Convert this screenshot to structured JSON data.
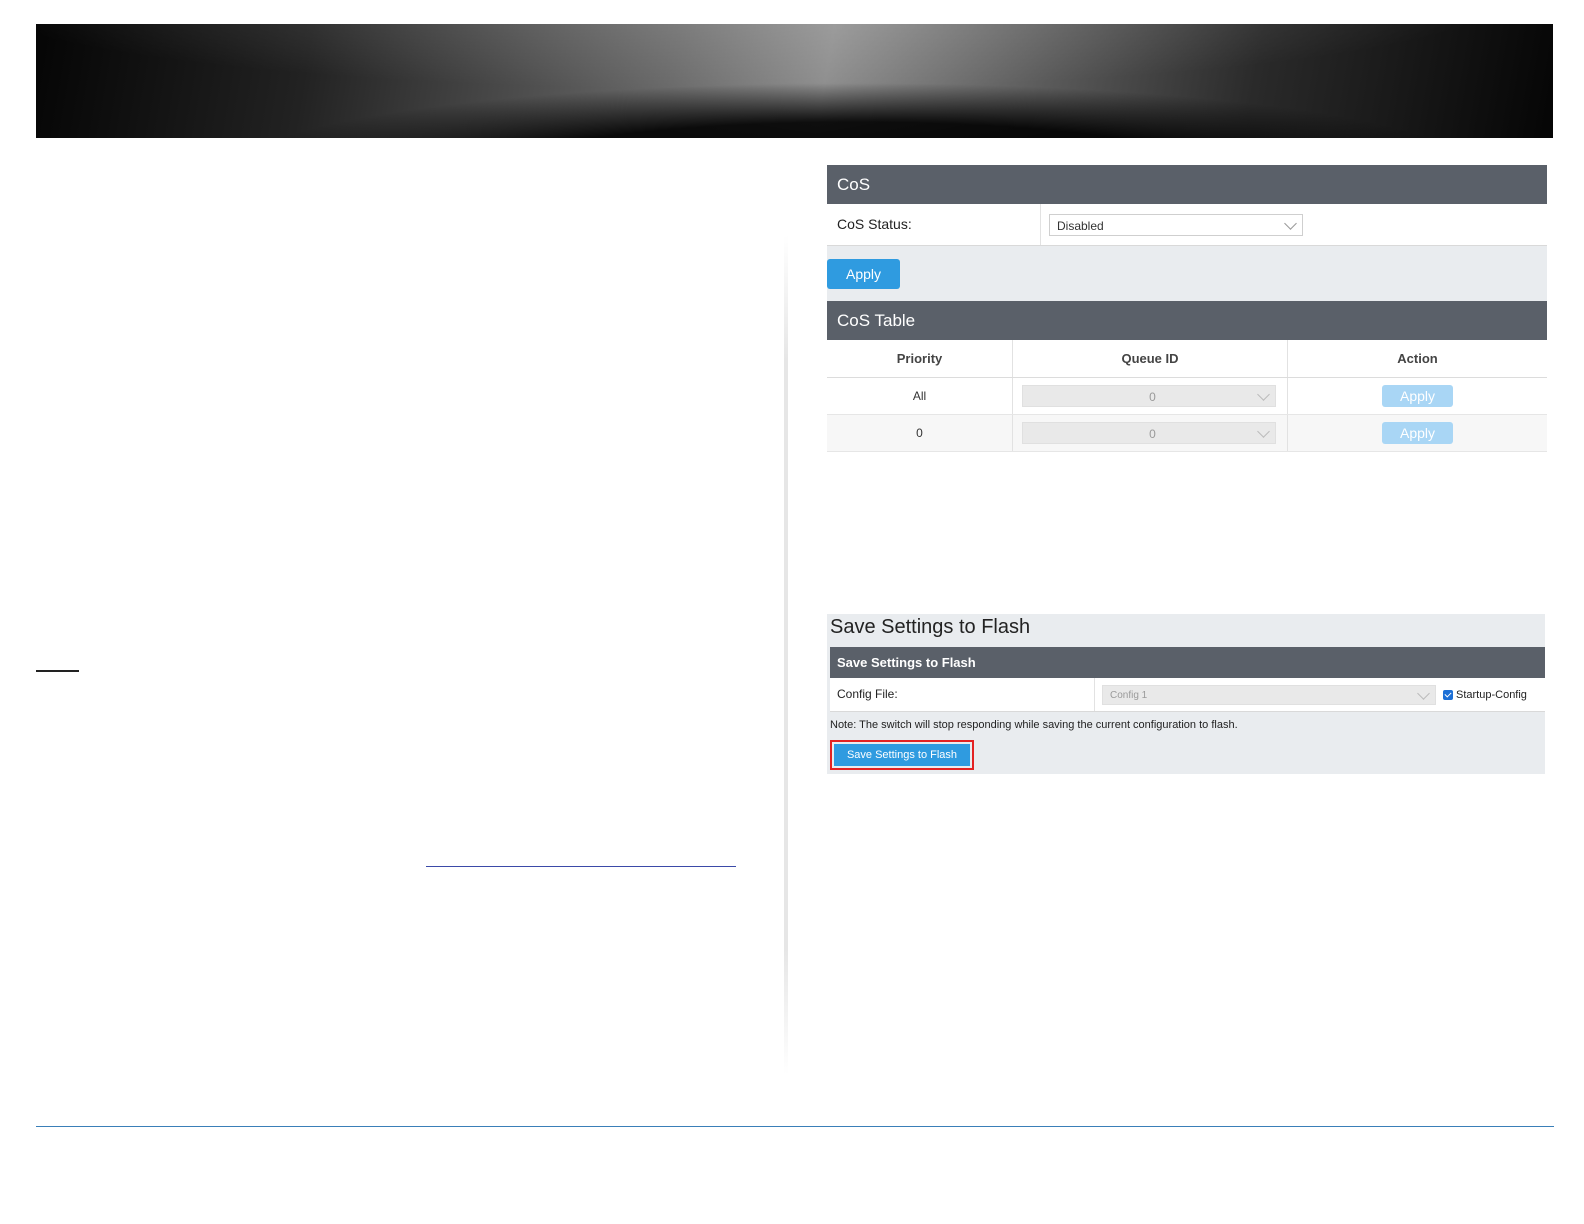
{
  "cos": {
    "header": "CoS",
    "status_label": "CoS Status:",
    "status_value": "Disabled",
    "apply_label": "Apply"
  },
  "cos_table": {
    "header": "CoS Table",
    "columns": [
      "Priority",
      "Queue ID",
      "Action"
    ],
    "rows": [
      {
        "priority": "All",
        "queue_id": "0",
        "action": "Apply"
      },
      {
        "priority": "0",
        "queue_id": "0",
        "action": "Apply"
      }
    ]
  },
  "save": {
    "title": "Save Settings to Flash",
    "header": "Save Settings to Flash",
    "config_label": "Config File:",
    "config_value": "Config 1",
    "startup_label": "Startup-Config",
    "note": "Note: The switch will stop responding while saving the current configuration to flash.",
    "button_label": "Save Settings to Flash"
  },
  "colors": {
    "panel_header": "#5a6069",
    "primary_button": "#2f9be0",
    "highlight_outline": "#e32222"
  }
}
